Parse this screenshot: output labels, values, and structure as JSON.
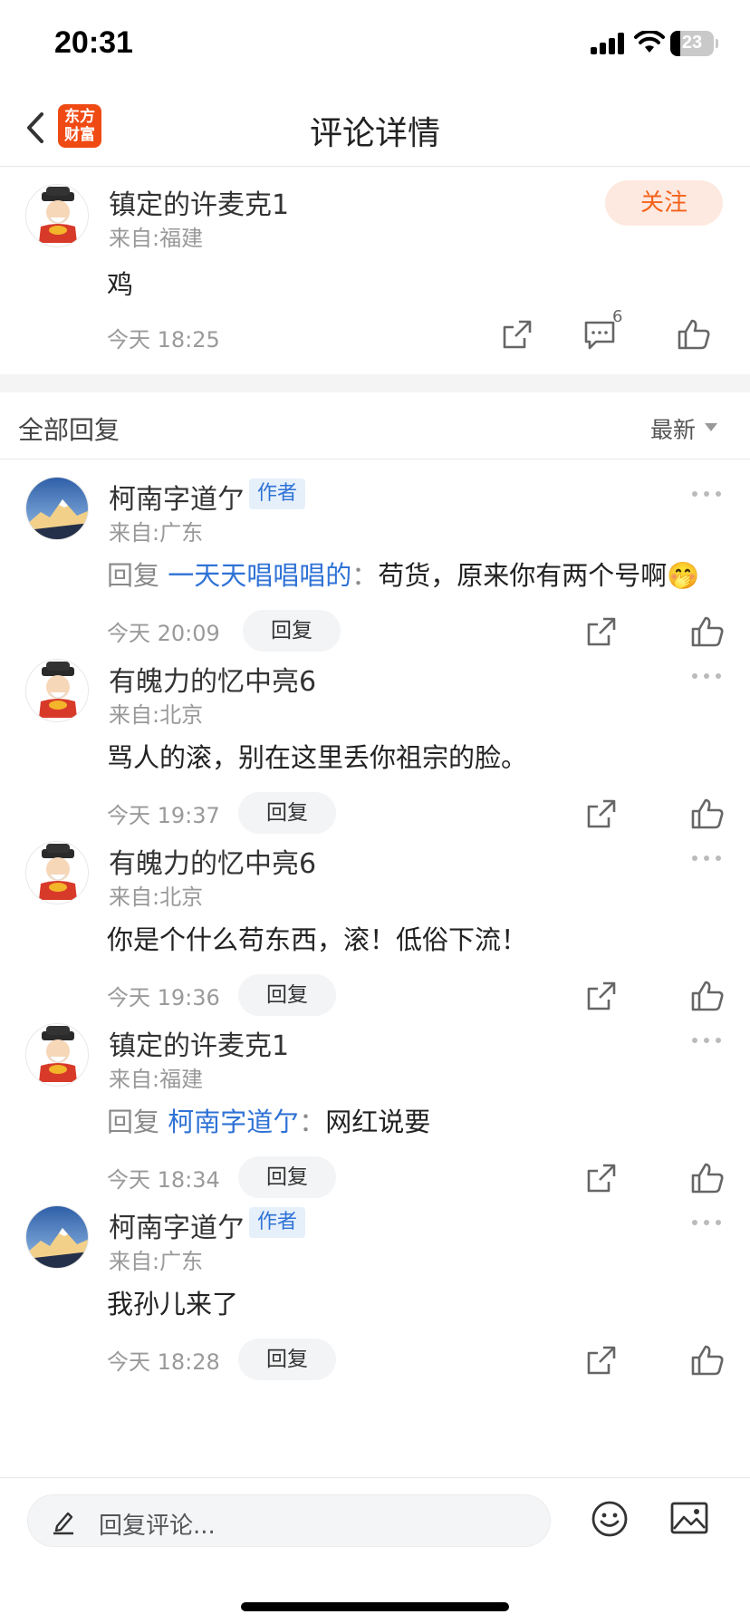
{
  "status_bar": {
    "time": "20:31",
    "battery": "23"
  },
  "nav": {
    "title": "评论详情",
    "logo_text": "东方财富",
    "back_icon": "chevron-left-icon"
  },
  "main_comment": {
    "username": "镇定的许麦克1",
    "location": "来自:福建",
    "follow_label": "关注",
    "text": "鸡",
    "time": "今天 18:25",
    "reply_count": "6",
    "icons": [
      "share-icon",
      "comment-icon",
      "like-icon"
    ]
  },
  "replies_header": {
    "title": "全部回复",
    "sort_label": "最新"
  },
  "replies": [
    {
      "username": "柯南字道亇",
      "badge": "作者",
      "location": "来自:广东",
      "prefix": "回复",
      "mention": "一天天唱唱唱的",
      "separator": "：",
      "text": "苟货，原来你有两个号啊🤭",
      "time": "今天 20:09",
      "reply_label": "回复",
      "avatar": "mountain"
    },
    {
      "username": "有魄力的忆中亮6",
      "badge": "",
      "location": "来自:北京",
      "prefix": "",
      "mention": "",
      "separator": "",
      "text": "骂人的滚，别在这里丢你祖宗的脸。",
      "time": "今天 19:37",
      "reply_label": "回复",
      "avatar": "fortune"
    },
    {
      "username": "有魄力的忆中亮6",
      "badge": "",
      "location": "来自:北京",
      "prefix": "",
      "mention": "",
      "separator": "",
      "text": "你是个什么苟东西，滚！低俗下流！",
      "time": "今天 19:36",
      "reply_label": "回复",
      "avatar": "fortune"
    },
    {
      "username": "镇定的许麦克1",
      "badge": "",
      "location": "来自:福建",
      "prefix": "回复",
      "mention": "柯南字道亇",
      "separator": "：",
      "text": "网红说要",
      "time": "今天 18:34",
      "reply_label": "回复",
      "avatar": "fortune"
    },
    {
      "username": "柯南字道亇",
      "badge": "作者",
      "location": "来自:广东",
      "prefix": "",
      "mention": "",
      "separator": "",
      "text": "我孙儿来了",
      "time": "今天 18:28",
      "reply_label": "回复",
      "avatar": "mountain"
    }
  ],
  "bottom_bar": {
    "placeholder": "回复评论...",
    "icons": [
      "pencil-icon",
      "emoji-icon",
      "image-icon"
    ]
  },
  "colors": {
    "accent": "#f5621a",
    "link": "#2f72d6",
    "logo_bg": "#f04a14"
  }
}
